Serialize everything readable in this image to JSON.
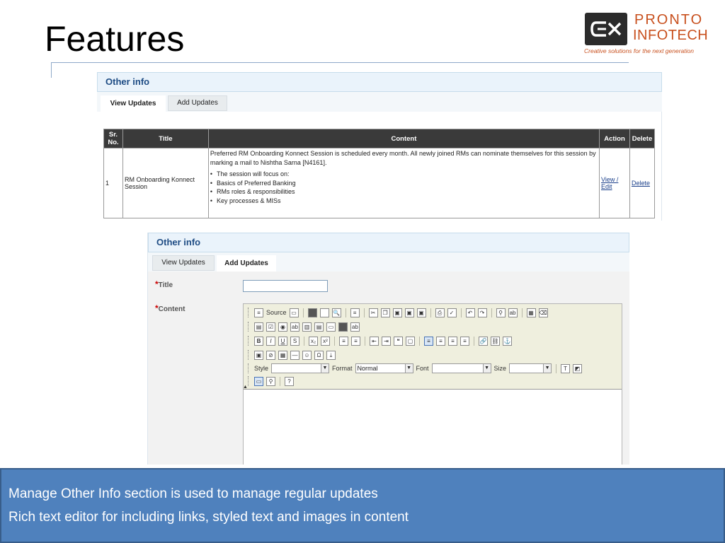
{
  "slide": {
    "title": "Features"
  },
  "logo": {
    "line1": "PRONTO",
    "line2": "INFOTECH",
    "tagline": "Creative solutions for the next generation",
    "brand_color": "#c8501e"
  },
  "view_panel": {
    "header": "Other info",
    "tabs": [
      {
        "label": "View Updates",
        "active": true
      },
      {
        "label": "Add Updates",
        "active": false
      }
    ],
    "table": {
      "columns": [
        "Sr. No.",
        "Title",
        "Content",
        "Action",
        "Delete"
      ],
      "rows": [
        {
          "sr": "1",
          "title": "RM Onboarding Konnect Session",
          "content_intro": "Preferred RM Onboarding Konnect Session is scheduled every month. All newly joined RMs can nominate themselves for this session by marking a mail to Nishtha Sarna [N4161].",
          "content_bullets": [
            "The session will focus on:",
            "Basics of Preferred Banking",
            "RMs roles & responsibilities",
            "Key processes & MISs"
          ],
          "action": "View / Edit",
          "delete": "Delete"
        }
      ]
    }
  },
  "add_panel": {
    "header": "Other info",
    "tabs": [
      {
        "label": "View Updates",
        "active": false
      },
      {
        "label": "Add Updates",
        "active": true
      }
    ],
    "title_label": "Title",
    "content_label": "Content",
    "title_value": "",
    "editor": {
      "source_label": "Source",
      "style_label": "Style",
      "format_label": "Format",
      "format_value": "Normal",
      "font_label": "Font",
      "size_label": "Size"
    }
  },
  "caption": {
    "line1": "Manage Other Info section is used to manage regular updates",
    "line2": "Rich text editor for including links, styled text and images in content"
  }
}
